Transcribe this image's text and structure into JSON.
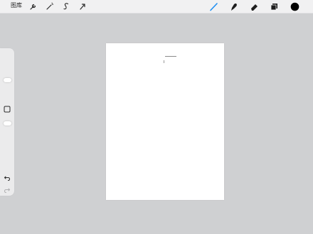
{
  "topbar": {
    "gallery_label": "图库",
    "left_tools": [
      {
        "icon": "wrench-icon"
      },
      {
        "icon": "magic-wand-icon"
      },
      {
        "icon": "selection-s-icon"
      },
      {
        "icon": "transform-arrow-icon"
      }
    ],
    "right_tools": [
      {
        "icon": "brush-icon",
        "active": true
      },
      {
        "icon": "smudge-icon"
      },
      {
        "icon": "eraser-icon"
      },
      {
        "icon": "layers-icon"
      },
      {
        "icon": "color-swatch-icon"
      }
    ]
  },
  "colors": {
    "active_tool": "#1f8ff2",
    "current_color": "#000000",
    "background": "#cfd0d2"
  },
  "sidebar": {
    "buttons": [
      "modify-square-icon",
      "undo-icon",
      "redo-icon"
    ]
  }
}
